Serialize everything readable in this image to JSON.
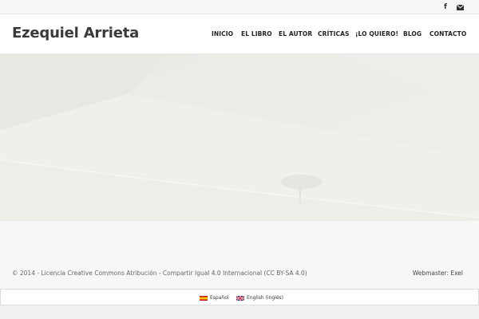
{
  "topbar": {
    "social": [
      {
        "name": "facebook",
        "glyph": "f"
      },
      {
        "name": "email",
        "glyph": ""
      }
    ]
  },
  "header": {
    "site_title": "Ezequiel Arrieta",
    "nav": [
      "INICIO",
      "EL LIBRO",
      "EL AUTOR",
      "CRÍTICAS",
      "¡LO QUIERO!",
      "BLOG",
      "CONTACTO"
    ]
  },
  "footer": {
    "license": "© 2014 - Licencia Creative Commons Atribución - Compartir Igual 4.0 Internacional (CC BY-SA 4.0)",
    "webmaster": "Webmaster: Exel"
  },
  "languages": [
    {
      "label": "Español",
      "flag": "es-flag-icon"
    },
    {
      "label": "English (inglés)",
      "flag": "uk-flag-icon"
    }
  ],
  "colors": {
    "hero_overlay": "#eef0ea",
    "title": "#3a3a3a",
    "nav": "#222222"
  }
}
